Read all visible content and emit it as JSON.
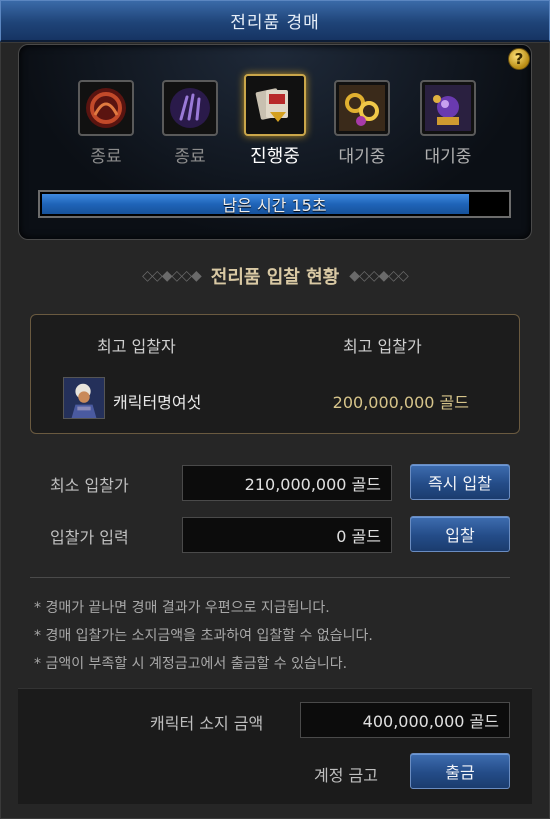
{
  "window": {
    "title": "전리품 경매"
  },
  "items": [
    {
      "label": "종료",
      "state": "ended",
      "icon": "red-swirl-emblem-icon"
    },
    {
      "label": "종료",
      "state": "ended",
      "icon": "purple-claw-emblem-icon"
    },
    {
      "label": "진행중",
      "state": "active",
      "icon": "card-bundle-icon"
    },
    {
      "label": "대기중",
      "state": "waiting",
      "icon": "golden-chain-icon"
    },
    {
      "label": "대기중",
      "state": "waiting",
      "icon": "orb-gauntlet-icon"
    }
  ],
  "timer": {
    "text": "남은 시간 15초",
    "progress": 0.91
  },
  "status": {
    "title": "전리품 입찰 현황",
    "top_bidder_header": "최고 입찰자",
    "top_bid_header": "최고 입찰가",
    "bidder_name": "캐릭터명여섯",
    "bid_amount": "200,000,000 골드"
  },
  "minimum": {
    "label": "최소 입찰가",
    "value": "210,000,000 골드",
    "button": "즉시 입찰"
  },
  "input": {
    "label": "입찰가 입력",
    "value": "0 골드",
    "button": "입찰"
  },
  "notices": [
    "* 경매가 끝나면 경매 결과가 우편으로 지급됩니다.",
    "* 경매 입찰가는 소지금액을 초과하여 입찰할 수 없습니다.",
    "* 금액이 부족할 시 계정금고에서 출금할 수 있습니다."
  ],
  "wallet": {
    "label": "캐릭터 소지 금액",
    "value": "400,000,000 골드"
  },
  "vault": {
    "label": "계정 금고",
    "button": "출금"
  },
  "colors": {
    "title_bar": "#1f4478",
    "accent_gold": "#caa64a",
    "button_blue": "#244c88"
  }
}
